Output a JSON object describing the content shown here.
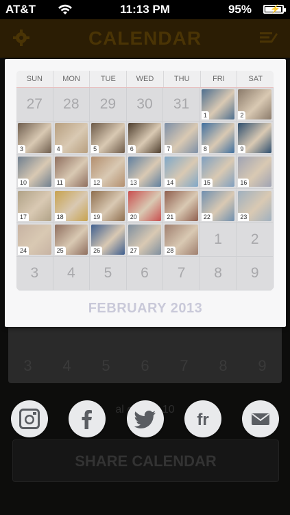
{
  "status_bar": {
    "carrier": "AT&T",
    "time": "11:13 PM",
    "battery_text": "95%",
    "battery_level": 0.95
  },
  "nav": {
    "title": "CALENDAR"
  },
  "calendar_modal": {
    "days_of_week": [
      "SUN",
      "MON",
      "TUE",
      "WED",
      "THU",
      "FRI",
      "SAT"
    ],
    "prev_month_days": [
      "27",
      "28",
      "29",
      "30",
      "31"
    ],
    "month_days": [
      "1",
      "2",
      "3",
      "4",
      "5",
      "6",
      "7",
      "8",
      "9",
      "10",
      "11",
      "12",
      "13",
      "14",
      "15",
      "16",
      "17",
      "18",
      "19",
      "20",
      "21",
      "22",
      "23",
      "24",
      "25",
      "26",
      "27",
      "28"
    ],
    "next_month_days_row5": [
      "1",
      "2"
    ],
    "next_month_days_row6": [
      "3",
      "4",
      "5",
      "6",
      "7",
      "8",
      "9"
    ],
    "month_label": "FEBRUARY 2013",
    "photo_colors": [
      "#4d6e8e",
      "#8a7a6a",
      "#6f5e4e",
      "#b79f7f",
      "#6d5a48",
      "#4f3f2f",
      "#7d8fa7",
      "#3f6f9f",
      "#2f4f6f",
      "#6f7f8f",
      "#8f6f5f",
      "#b38f6f",
      "#5f7f9f",
      "#7fa7c7",
      "#7f9fbf",
      "#9fa3b3",
      "#b0a287",
      "#c7a24f",
      "#8f6f4f",
      "#c84f4f",
      "#8f5f4f",
      "#6f8faf",
      "#9fb0bf",
      "#c7b3a3",
      "#8f6f5f",
      "#3f5f8f",
      "#7f8f9f",
      "#9f7f6f"
    ]
  },
  "background": {
    "caption": "al ca              yan 10",
    "share_button_label": "SHARE CALENDAR",
    "bg_row_days": [
      "3",
      "4",
      "5",
      "6",
      "7",
      "8",
      "9"
    ]
  },
  "share_icons": [
    "instagram-icon",
    "facebook-icon",
    "twitter-icon",
    "flickr-icon",
    "email-icon"
  ]
}
